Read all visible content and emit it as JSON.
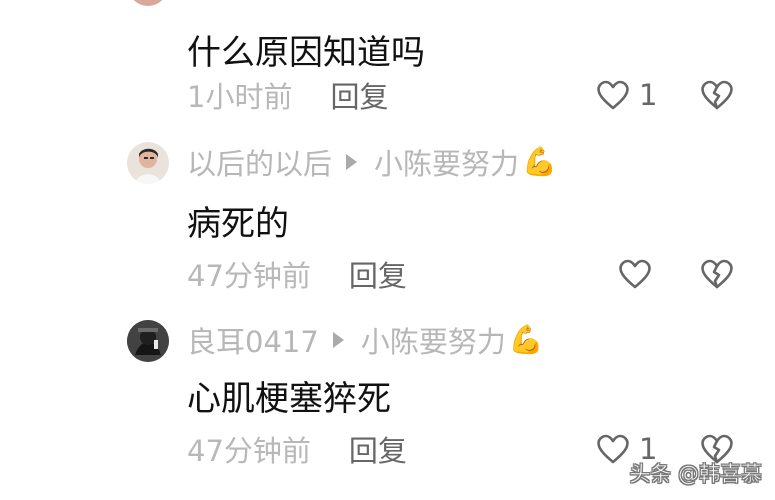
{
  "comments": [
    {
      "text": "什么原因知道吗",
      "time": "1小时前",
      "reply_label": "回复",
      "like_count": "1"
    },
    {
      "author": "以后的以后",
      "reply_to": "小陈要努力",
      "text": "病死的",
      "time": "47分钟前",
      "reply_label": "回复"
    },
    {
      "author": "良耳0417",
      "reply_to": "小陈要努力",
      "text": "心肌梗塞猝死",
      "time": "47分钟前",
      "reply_label": "回复",
      "like_count": "1"
    }
  ],
  "watermark": {
    "text": "头条 @韩喜慕"
  },
  "icons": {
    "like": "heart-outline-icon",
    "dislike": "broken-heart-icon",
    "reply_arrow": "triangle-arrow-icon",
    "emoji": "flexed-biceps-icon"
  },
  "colors": {
    "background": "#ffffff",
    "primary_text": "#111111",
    "secondary_text": "#b8b8b8",
    "action_text": "#666666",
    "icon": "#666666"
  }
}
